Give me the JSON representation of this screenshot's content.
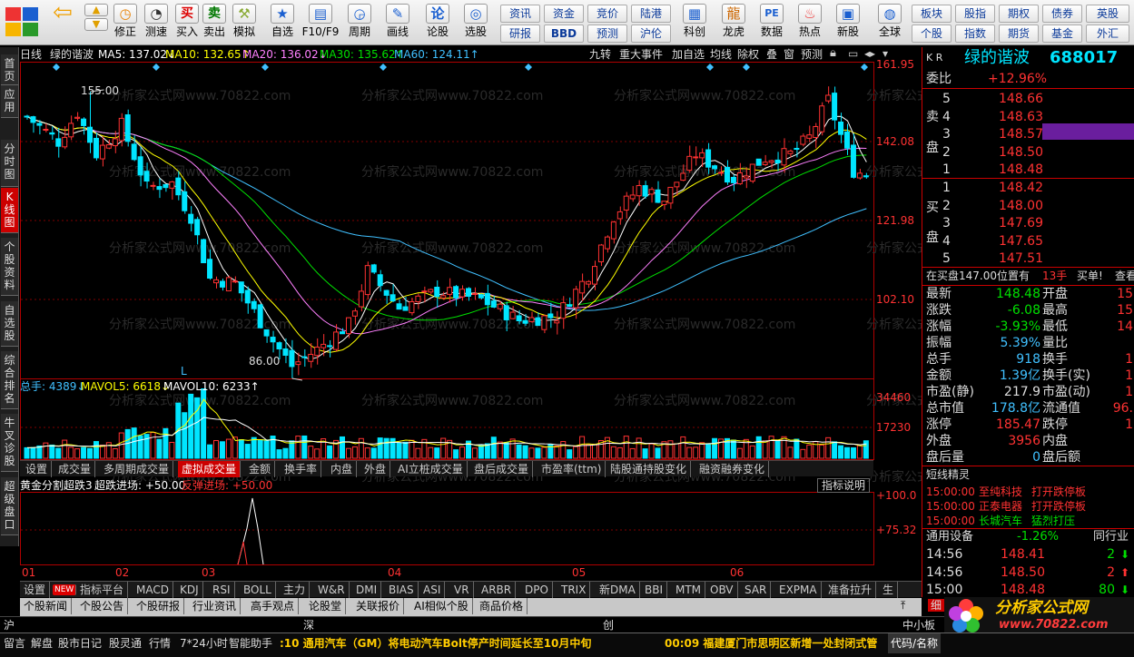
{
  "toolbar": {
    "buttons": [
      "修正",
      "测速",
      "买入",
      "卖出",
      "模拟",
      "自选",
      "F10/F9",
      "周期",
      "画线",
      "论股",
      "选股",
      "科创",
      "龙虎",
      "数据",
      "热点",
      "新股",
      "全球"
    ],
    "small": [
      "资讯",
      "资金",
      "竞价",
      "陆港",
      "研报",
      "BBD",
      "预测",
      "沪伦",
      "板块",
      "股指",
      "期权",
      "债券",
      "英股",
      "个股",
      "指数",
      "期货",
      "基金",
      "外汇"
    ]
  },
  "left_tabs": [
    "首页",
    "应用",
    "分时图",
    "K线图",
    "个股资料",
    "自选股",
    "综合排名",
    "牛叉诊股",
    "超级盘口"
  ],
  "chart": {
    "header": {
      "period": "日线",
      "name": "绿的谐波",
      "ma5": "MA5: 137.02↓",
      "ma10": "MA10: 132.65↑",
      "ma20": "MA20: 136.02↓",
      "ma30": "MA30: 135.62↑",
      "ma60": "MA60: 124.11↑"
    },
    "header_right": [
      "九转",
      "重大事件",
      "加自选",
      "均线",
      "除权",
      "叠",
      "窗",
      "预测"
    ],
    "price_ticks": [
      "161.95",
      "142.08",
      "121.98",
      "102.10"
    ],
    "annot_high": "155.00",
    "annot_low": "86.00",
    "annot_L": "L",
    "vol_header": {
      "total": "总手: 4389↓",
      "mavol5": "MAVOL5: 6618↓",
      "mavol10": "MAVOL10: 6233↑"
    },
    "vol_ticks": [
      "34460",
      "17230"
    ],
    "ind_tabs": [
      "设置",
      "成交量",
      "多周期成交量",
      "虚拟成交量",
      "金额",
      "换手率",
      "内盘",
      "外盘",
      "AI立桩成交量",
      "盘后成交量",
      "市盈率(ttm)",
      "陆股通持股变化",
      "融资融券变化"
    ],
    "ind_header": {
      "name": "黄金分割超跌3",
      "s1": "超跌进场: +50.00",
      "s2": "反弹进场: +50.00"
    },
    "ind_help": "指标说明",
    "ind_ticks": [
      "+100.0",
      "+75.32"
    ],
    "months": [
      "01",
      "02",
      "03",
      "04",
      "05",
      "06"
    ],
    "bottom_tabs": [
      "设置",
      "NEW",
      "指标平台",
      "MACD",
      "KDJ",
      "RSI",
      "BOLL",
      "主力",
      "W&R",
      "DMI",
      "BIAS",
      "ASI",
      "VR",
      "ARBR",
      "DPO",
      "TRIX",
      "新DMA",
      "BBI",
      "MTM",
      "OBV",
      "SAR",
      "EXPMA",
      "准备拉升",
      "生"
    ],
    "info_tabs": [
      "个股新闻",
      "个股公告",
      "个股研报",
      "行业资讯",
      "高手观点",
      "论股堂",
      "关联报价",
      "AI相似个股",
      "商品价格"
    ],
    "watermark": "分析家公式网www.70822.com",
    "colors": {
      "up": "#ff3232",
      "down": "#00e5ff",
      "ma5": "#ffffff",
      "ma10": "#ffff00",
      "ma20": "#ff80ff",
      "ma30": "#00e000",
      "ma60": "#40c0ff"
    }
  },
  "chart_data": {
    "type": "candlestick",
    "ylim": [
      86,
      162
    ],
    "series": [
      {
        "name": "MA5",
        "value": 137.02
      },
      {
        "name": "MA10",
        "value": 132.65
      },
      {
        "name": "MA20",
        "value": 136.02
      },
      {
        "name": "MA30",
        "value": 135.62
      },
      {
        "name": "MA60",
        "value": 124.11
      }
    ],
    "high": 155.0,
    "low": 86.0
  },
  "quote": {
    "kr": "K R",
    "name": "绿的谐波",
    "code": "688017",
    "weibi_label": "委比",
    "weibi": "+12.96%",
    "sell_label": [
      "卖",
      "盘"
    ],
    "buy_label": [
      "买",
      "盘"
    ],
    "asks": [
      {
        "n": "5",
        "p": "148.66"
      },
      {
        "n": "4",
        "p": "148.63"
      },
      {
        "n": "3",
        "p": "148.57"
      },
      {
        "n": "2",
        "p": "148.50"
      },
      {
        "n": "1",
        "p": "148.48"
      }
    ],
    "bids": [
      {
        "n": "1",
        "p": "148.42"
      },
      {
        "n": "2",
        "p": "148.00"
      },
      {
        "n": "3",
        "p": "147.69"
      },
      {
        "n": "4",
        "p": "147.65"
      },
      {
        "n": "5",
        "p": "147.51"
      }
    ],
    "tip": "在买盘147.00位置有",
    "tip_qty": "13手",
    "tip_act": "买单!",
    "tip_more": "查看",
    "stats": [
      {
        "l1": "最新",
        "v1": "148.48",
        "l2": "开盘",
        "v2": "15"
      },
      {
        "l1": "涨跌",
        "v1": "-6.08",
        "l2": "最高",
        "v2": "15"
      },
      {
        "l1": "涨幅",
        "v1": "-3.93%",
        "l2": "最低",
        "v2": "14"
      },
      {
        "l1": "振幅",
        "v1": "5.39%",
        "l2": "量比",
        "v2": ""
      },
      {
        "l1": "总手",
        "v1": "918",
        "l2": "换手",
        "v2": "1"
      },
      {
        "l1": "金额",
        "v1": "1.39亿",
        "l2": "换手(实)",
        "v2": "1"
      },
      {
        "l1": "市盈(静)",
        "v1": "217.9",
        "l2": "市盈(动)",
        "v2": "1"
      },
      {
        "l1": "总市值",
        "v1": "178.8亿",
        "l2": "流通值",
        "v2": "96."
      },
      {
        "l1": "涨停",
        "v1": "185.47",
        "l2": "跌停",
        "v2": "1"
      },
      {
        "l1": "外盘",
        "v1": "3956",
        "l2": "内盘",
        "v2": ""
      },
      {
        "l1": "盘后量",
        "v1": "0",
        "l2": "盘后额",
        "v2": ""
      }
    ],
    "short_title": "短线精灵",
    "short": [
      {
        "t": "15:00:00",
        "n": "至纯科技",
        "a": "打开跌停板"
      },
      {
        "t": "15:00:00",
        "n": "正泰电器",
        "a": "打开跌停板"
      },
      {
        "t": "15:00:00",
        "n": "长城汽车",
        "a": "猛烈打压"
      }
    ],
    "industry": "通用设备",
    "industry_chg": "-1.26%",
    "industry_more": "同行业",
    "ticks": [
      {
        "t": "14:56",
        "p": "148.41",
        "v": "2",
        "d": "down"
      },
      {
        "t": "14:56",
        "p": "148.50",
        "v": "2",
        "d": "up"
      },
      {
        "t": "15:00",
        "p": "148.48",
        "v": "80",
        "d": "down"
      }
    ],
    "vert_tab": "细"
  },
  "status": {
    "hu": "沪",
    "shen": "深",
    "chuang": "创",
    "zxb": "中小板",
    "items": [
      "留言",
      "解盘",
      "股市日记",
      "股灵通",
      "行情",
      "7*24小时",
      "智能助手"
    ],
    "news1": ":10 通用汽车（GM）将电动汽车Bolt停产时间延长至10月中旬",
    "news2": "00:09 福建厦门市思明区新增一处封闭式管",
    "code_label": "代码/名称"
  },
  "logo": {
    "name": "分析家公式网",
    "url": "www.70822.com"
  }
}
